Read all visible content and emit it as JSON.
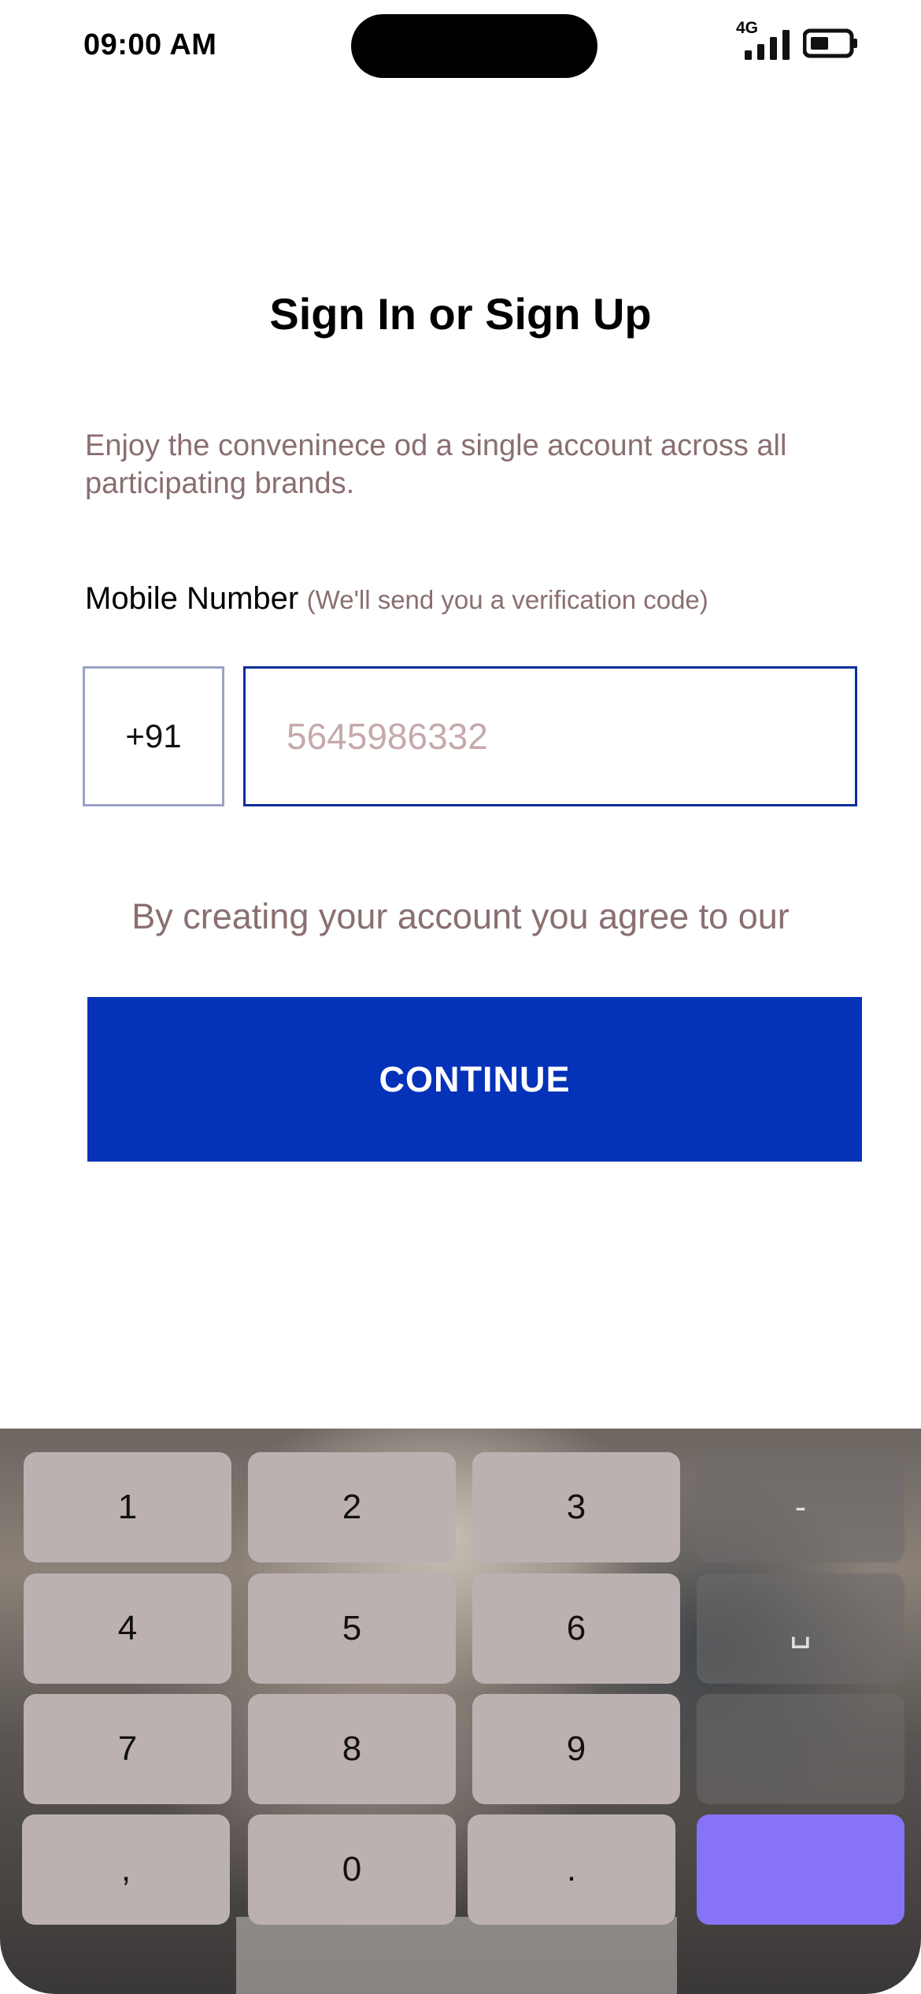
{
  "status_bar": {
    "time": "09:00 AM",
    "network": "4G"
  },
  "page": {
    "title": "Sign In or Sign Up",
    "intro": "Enjoy the conveninece od a single account across all participating brands."
  },
  "form": {
    "mobile_label": "Mobile Number",
    "mobile_hint": "(We'll send you a verification code)",
    "country_code": "+91",
    "mobile_placeholder": "5645986332",
    "terms": "By creating your account you agree to our",
    "continue_label": "CONTINUE"
  },
  "keyboard": {
    "keys": [
      "1",
      "2",
      "3",
      "-",
      "4",
      "5",
      "6",
      "␣",
      "7",
      "8",
      "9",
      "",
      ",",
      "0",
      ".",
      ""
    ],
    "accent_color": "#8673f5"
  },
  "colors": {
    "primary": "#0432b8",
    "muted_text": "#8a6f70",
    "input_border": "#0a2f9a"
  }
}
